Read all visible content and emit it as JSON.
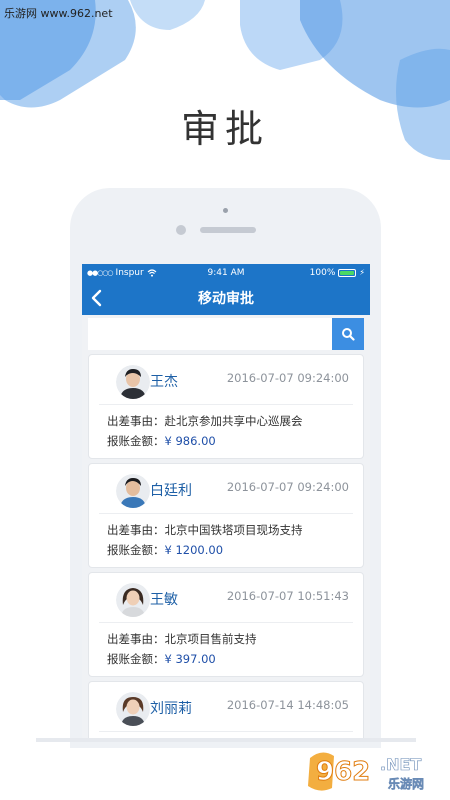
{
  "watermark_top": "乐游网 www.962.net",
  "page_title": "审批",
  "status_bar": {
    "carrier": "Inspur",
    "time": "9:41 AM",
    "battery": "100%"
  },
  "nav": {
    "title": "移动审批"
  },
  "search": {
    "placeholder": ""
  },
  "labels": {
    "trip_reason": "出差事由：",
    "amount": "报账金额："
  },
  "records": [
    {
      "name": "王杰",
      "time": "2016-07-07 09:24:00",
      "reason": "赴北京参加共享中心巡展会",
      "amount": "¥ 986.00"
    },
    {
      "name": "白廷利",
      "time": "2016-07-07 09:24:00",
      "reason": "北京中国铁塔项目现场支持",
      "amount": "¥ 1200.00"
    },
    {
      "name": "王敏",
      "time": "2016-07-07 10:51:43",
      "reason": "北京项目售前支持",
      "amount": "¥ 397.00"
    },
    {
      "name": "刘丽莉",
      "time": "2016-07-14 14:48:05"
    }
  ],
  "watermark_logo": {
    "number": "962",
    "suffix": ".NET",
    "cn": "乐游网"
  },
  "colors": {
    "nav": "#1d75c8",
    "accent": "#3c8ee2",
    "amount": "#1f4fa8",
    "name": "#1d5fa6"
  },
  "icons": {
    "back": "chevron-left-icon",
    "search": "search-icon",
    "wifi": "wifi-icon",
    "battery": "battery-icon"
  }
}
